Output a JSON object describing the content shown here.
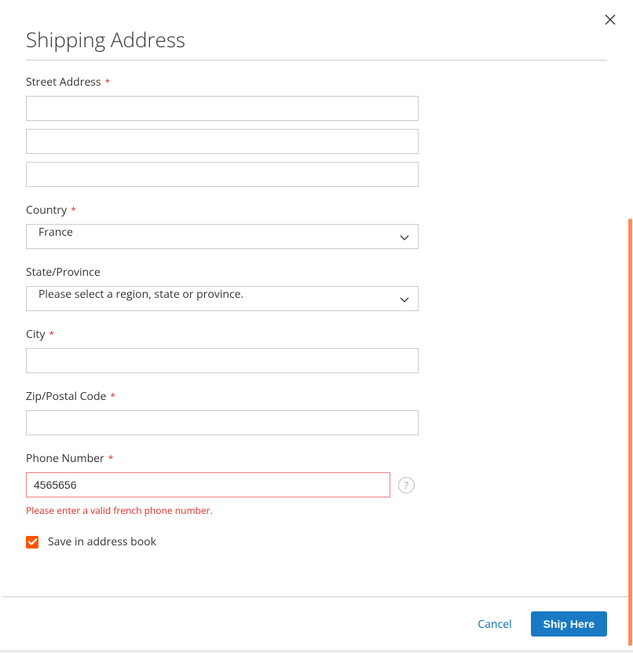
{
  "modal": {
    "title": "Shipping Address",
    "close_aria": "Close"
  },
  "fields": {
    "street": {
      "label": "Street Address",
      "line1": "",
      "line2": "",
      "line3": ""
    },
    "country": {
      "label": "Country",
      "selected": "France"
    },
    "region": {
      "label": "State/Province",
      "selected": "Please select a region, state or province."
    },
    "city": {
      "label": "City",
      "value": ""
    },
    "zip": {
      "label": "Zip/Postal Code",
      "value": ""
    },
    "phone": {
      "label": "Phone Number",
      "value": "4565656",
      "error": "Please enter a valid french phone number."
    },
    "save_book": {
      "label": "Save in address book",
      "checked": true
    }
  },
  "actions": {
    "cancel": "Cancel",
    "ship": "Ship Here"
  }
}
